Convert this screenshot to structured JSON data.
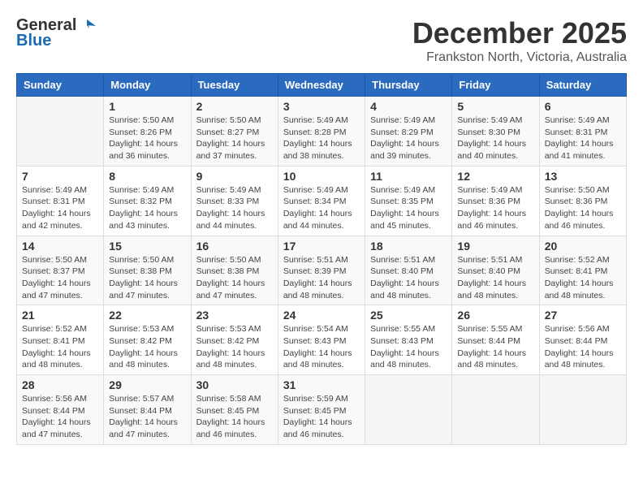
{
  "header": {
    "logo_general": "General",
    "logo_blue": "Blue",
    "month_title": "December 2025",
    "location": "Frankston North, Victoria, Australia"
  },
  "days_of_week": [
    "Sunday",
    "Monday",
    "Tuesday",
    "Wednesday",
    "Thursday",
    "Friday",
    "Saturday"
  ],
  "weeks": [
    [
      {
        "day": "",
        "info": ""
      },
      {
        "day": "1",
        "info": "Sunrise: 5:50 AM\nSunset: 8:26 PM\nDaylight: 14 hours\nand 36 minutes."
      },
      {
        "day": "2",
        "info": "Sunrise: 5:50 AM\nSunset: 8:27 PM\nDaylight: 14 hours\nand 37 minutes."
      },
      {
        "day": "3",
        "info": "Sunrise: 5:49 AM\nSunset: 8:28 PM\nDaylight: 14 hours\nand 38 minutes."
      },
      {
        "day": "4",
        "info": "Sunrise: 5:49 AM\nSunset: 8:29 PM\nDaylight: 14 hours\nand 39 minutes."
      },
      {
        "day": "5",
        "info": "Sunrise: 5:49 AM\nSunset: 8:30 PM\nDaylight: 14 hours\nand 40 minutes."
      },
      {
        "day": "6",
        "info": "Sunrise: 5:49 AM\nSunset: 8:31 PM\nDaylight: 14 hours\nand 41 minutes."
      }
    ],
    [
      {
        "day": "7",
        "info": "Sunrise: 5:49 AM\nSunset: 8:31 PM\nDaylight: 14 hours\nand 42 minutes."
      },
      {
        "day": "8",
        "info": "Sunrise: 5:49 AM\nSunset: 8:32 PM\nDaylight: 14 hours\nand 43 minutes."
      },
      {
        "day": "9",
        "info": "Sunrise: 5:49 AM\nSunset: 8:33 PM\nDaylight: 14 hours\nand 44 minutes."
      },
      {
        "day": "10",
        "info": "Sunrise: 5:49 AM\nSunset: 8:34 PM\nDaylight: 14 hours\nand 44 minutes."
      },
      {
        "day": "11",
        "info": "Sunrise: 5:49 AM\nSunset: 8:35 PM\nDaylight: 14 hours\nand 45 minutes."
      },
      {
        "day": "12",
        "info": "Sunrise: 5:49 AM\nSunset: 8:36 PM\nDaylight: 14 hours\nand 46 minutes."
      },
      {
        "day": "13",
        "info": "Sunrise: 5:50 AM\nSunset: 8:36 PM\nDaylight: 14 hours\nand 46 minutes."
      }
    ],
    [
      {
        "day": "14",
        "info": "Sunrise: 5:50 AM\nSunset: 8:37 PM\nDaylight: 14 hours\nand 47 minutes."
      },
      {
        "day": "15",
        "info": "Sunrise: 5:50 AM\nSunset: 8:38 PM\nDaylight: 14 hours\nand 47 minutes."
      },
      {
        "day": "16",
        "info": "Sunrise: 5:50 AM\nSunset: 8:38 PM\nDaylight: 14 hours\nand 47 minutes."
      },
      {
        "day": "17",
        "info": "Sunrise: 5:51 AM\nSunset: 8:39 PM\nDaylight: 14 hours\nand 48 minutes."
      },
      {
        "day": "18",
        "info": "Sunrise: 5:51 AM\nSunset: 8:40 PM\nDaylight: 14 hours\nand 48 minutes."
      },
      {
        "day": "19",
        "info": "Sunrise: 5:51 AM\nSunset: 8:40 PM\nDaylight: 14 hours\nand 48 minutes."
      },
      {
        "day": "20",
        "info": "Sunrise: 5:52 AM\nSunset: 8:41 PM\nDaylight: 14 hours\nand 48 minutes."
      }
    ],
    [
      {
        "day": "21",
        "info": "Sunrise: 5:52 AM\nSunset: 8:41 PM\nDaylight: 14 hours\nand 48 minutes."
      },
      {
        "day": "22",
        "info": "Sunrise: 5:53 AM\nSunset: 8:42 PM\nDaylight: 14 hours\nand 48 minutes."
      },
      {
        "day": "23",
        "info": "Sunrise: 5:53 AM\nSunset: 8:42 PM\nDaylight: 14 hours\nand 48 minutes."
      },
      {
        "day": "24",
        "info": "Sunrise: 5:54 AM\nSunset: 8:43 PM\nDaylight: 14 hours\nand 48 minutes."
      },
      {
        "day": "25",
        "info": "Sunrise: 5:55 AM\nSunset: 8:43 PM\nDaylight: 14 hours\nand 48 minutes."
      },
      {
        "day": "26",
        "info": "Sunrise: 5:55 AM\nSunset: 8:44 PM\nDaylight: 14 hours\nand 48 minutes."
      },
      {
        "day": "27",
        "info": "Sunrise: 5:56 AM\nSunset: 8:44 PM\nDaylight: 14 hours\nand 48 minutes."
      }
    ],
    [
      {
        "day": "28",
        "info": "Sunrise: 5:56 AM\nSunset: 8:44 PM\nDaylight: 14 hours\nand 47 minutes."
      },
      {
        "day": "29",
        "info": "Sunrise: 5:57 AM\nSunset: 8:44 PM\nDaylight: 14 hours\nand 47 minutes."
      },
      {
        "day": "30",
        "info": "Sunrise: 5:58 AM\nSunset: 8:45 PM\nDaylight: 14 hours\nand 46 minutes."
      },
      {
        "day": "31",
        "info": "Sunrise: 5:59 AM\nSunset: 8:45 PM\nDaylight: 14 hours\nand 46 minutes."
      },
      {
        "day": "",
        "info": ""
      },
      {
        "day": "",
        "info": ""
      },
      {
        "day": "",
        "info": ""
      }
    ]
  ]
}
